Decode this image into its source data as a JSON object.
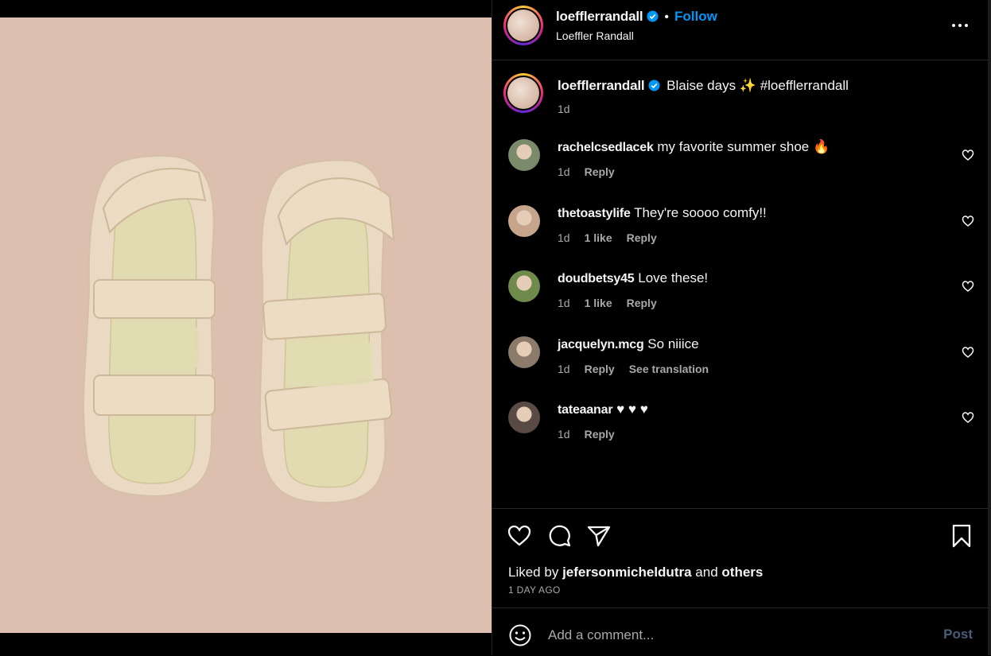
{
  "post": {
    "username": "loefflerrandall",
    "follow_label": "Follow",
    "dot": "•",
    "full_name": "Loeffler Randall",
    "caption": "Blaise days ✨ #loefflerrandall",
    "caption_age": "1d",
    "image_subject": "pair of woven beige velcro-strap sandals on a pink background"
  },
  "comments": [
    {
      "username": "rachelcsedlacek",
      "text": "my favorite summer shoe 🔥",
      "age": "1d",
      "likes": "",
      "reply": "Reply",
      "translate": "",
      "avatar_color": "#7a8a6a"
    },
    {
      "username": "thetoastylife",
      "text": "They're soooo comfy!!",
      "age": "1d",
      "likes": "1 like",
      "reply": "Reply",
      "translate": "",
      "avatar_color": "#c7a58c"
    },
    {
      "username": "doudbetsy45",
      "text": "Love these!",
      "age": "1d",
      "likes": "1 like",
      "reply": "Reply",
      "translate": "",
      "avatar_color": "#6f8a4a"
    },
    {
      "username": "jacquelyn.mcg",
      "text": "So niiice",
      "age": "1d",
      "likes": "",
      "reply": "Reply",
      "translate": "See translation",
      "avatar_color": "#8c7a6a"
    },
    {
      "username": "tateaanar",
      "text": "♥ ♥ ♥",
      "age": "1d",
      "likes": "",
      "reply": "Reply",
      "translate": "",
      "avatar_color": "#5a4a44"
    }
  ],
  "likes": {
    "prefix": "Liked by",
    "user": "jefersonmicheldutra",
    "middle": "and",
    "others": "others",
    "time_ago": "1 DAY AGO"
  },
  "comment_box": {
    "placeholder": "Add a comment...",
    "post_label": "Post"
  },
  "icons": {
    "more": "more-options-icon",
    "like": "heart-icon",
    "comment": "comment-icon",
    "share": "send-icon",
    "save": "bookmark-icon",
    "emoji": "emoji-icon",
    "verified": "verified-badge-icon"
  },
  "colors": {
    "accent": "#0095f6",
    "background": "#000000",
    "muted": "#a8a8a8",
    "photo_bg": "#dcbfae"
  }
}
